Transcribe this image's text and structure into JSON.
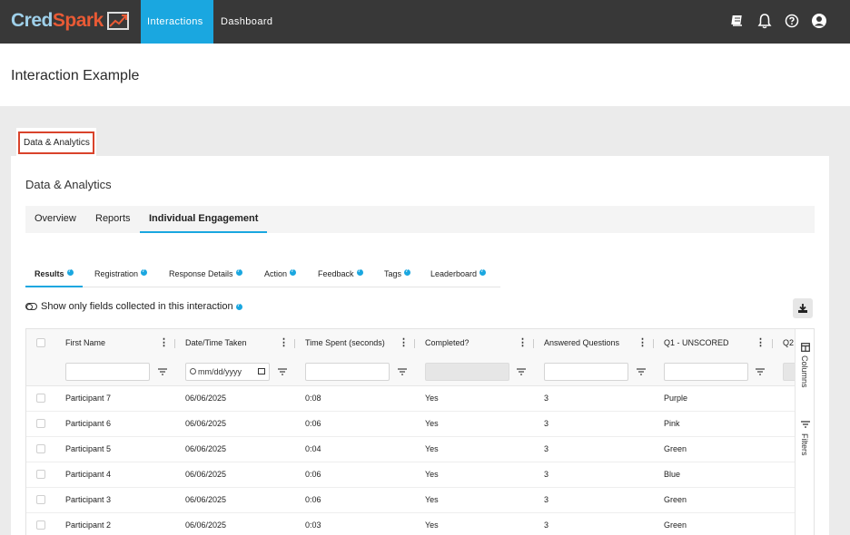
{
  "nav": {
    "logo_cred": "Cred",
    "logo_spark": "Spark",
    "tabs": [
      {
        "label": "Interactions",
        "active": true
      },
      {
        "label": "Dashboard",
        "active": false
      }
    ],
    "icons": [
      "book-icon",
      "bell-icon",
      "help-icon",
      "user-icon"
    ],
    "accent_color": "#1aa7e0"
  },
  "page": {
    "title": "Interaction Example",
    "outer_tab": "Data & Analytics"
  },
  "card": {
    "title": "Data & Analytics",
    "subtabs": [
      "Overview",
      "Reports",
      "Individual Engagement"
    ],
    "section_tabs": [
      "Results",
      "Registration",
      "Response Details",
      "Action",
      "Feedback",
      "Tags",
      "Leaderboard"
    ],
    "toggle_label": "Show only fields collected in this interaction"
  },
  "grid": {
    "columns": [
      "First Name",
      "Date/Time Taken",
      "Time Spent (seconds)",
      "Completed?",
      "Answered Questions",
      "Q1 - UNSCORED",
      "Q2"
    ],
    "date_placeholder": "mm/dd/yyyy",
    "rows": [
      [
        "Participant 7",
        "06/06/2025",
        "0:08",
        "Yes",
        "3",
        "Purple"
      ],
      [
        "Participant 6",
        "06/06/2025",
        "0:06",
        "Yes",
        "3",
        "Pink"
      ],
      [
        "Participant 5",
        "06/06/2025",
        "0:04",
        "Yes",
        "3",
        "Green"
      ],
      [
        "Participant 4",
        "06/06/2025",
        "0:06",
        "Yes",
        "3",
        "Blue"
      ],
      [
        "Participant 3",
        "06/06/2025",
        "0:06",
        "Yes",
        "3",
        "Green"
      ],
      [
        "Participant 2",
        "06/06/2025",
        "0:03",
        "Yes",
        "3",
        "Green"
      ]
    ],
    "side_panel": {
      "columns": "Columns",
      "filters": "Filters"
    }
  }
}
